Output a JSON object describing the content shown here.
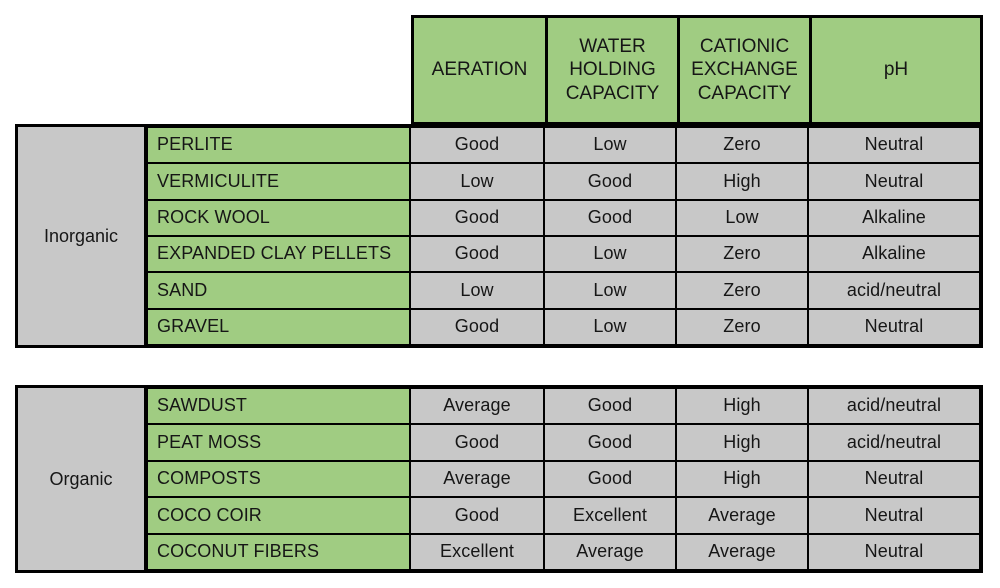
{
  "table": {
    "column_headers": [
      "AERATION",
      "WATER HOLDING CAPACITY",
      "CATIONIC EXCHANGE CAPACITY",
      "pH"
    ],
    "colors": {
      "header_green": "#a0cc82",
      "material_green": "#a0cc82",
      "data_gray": "#c8c8c8",
      "border": "#000000"
    },
    "groups": [
      {
        "label": "Inorganic",
        "rows": [
          {
            "material": "PERLITE",
            "aeration": "Good",
            "water_holding_capacity": "Low",
            "cationic_exchange_capacity": "Zero",
            "ph": "Neutral"
          },
          {
            "material": "VERMICULITE",
            "aeration": "Low",
            "water_holding_capacity": "Good",
            "cationic_exchange_capacity": "High",
            "ph": "Neutral"
          },
          {
            "material": "ROCK WOOL",
            "aeration": "Good",
            "water_holding_capacity": "Good",
            "cationic_exchange_capacity": "Low",
            "ph": "Alkaline"
          },
          {
            "material": "EXPANDED CLAY PELLETS",
            "aeration": "Good",
            "water_holding_capacity": "Low",
            "cationic_exchange_capacity": "Zero",
            "ph": "Alkaline"
          },
          {
            "material": "SAND",
            "aeration": "Low",
            "water_holding_capacity": "Low",
            "cationic_exchange_capacity": "Zero",
            "ph": "acid/neutral"
          },
          {
            "material": "GRAVEL",
            "aeration": "Good",
            "water_holding_capacity": "Low",
            "cationic_exchange_capacity": "Zero",
            "ph": "Neutral"
          }
        ]
      },
      {
        "label": "Organic",
        "rows": [
          {
            "material": "SAWDUST",
            "aeration": "Average",
            "water_holding_capacity": "Good",
            "cationic_exchange_capacity": "High",
            "ph": "acid/neutral"
          },
          {
            "material": "PEAT MOSS",
            "aeration": "Good",
            "water_holding_capacity": "Good",
            "cationic_exchange_capacity": "High",
            "ph": "acid/neutral"
          },
          {
            "material": "COMPOSTS",
            "aeration": "Average",
            "water_holding_capacity": "Good",
            "cationic_exchange_capacity": "High",
            "ph": "Neutral"
          },
          {
            "material": "COCO COIR",
            "aeration": "Good",
            "water_holding_capacity": "Excellent",
            "cationic_exchange_capacity": "Average",
            "ph": "Neutral"
          },
          {
            "material": "COCONUT FIBERS",
            "aeration": "Excellent",
            "water_holding_capacity": "Average",
            "cationic_exchange_capacity": "Average",
            "ph": "Neutral"
          }
        ]
      }
    ]
  }
}
